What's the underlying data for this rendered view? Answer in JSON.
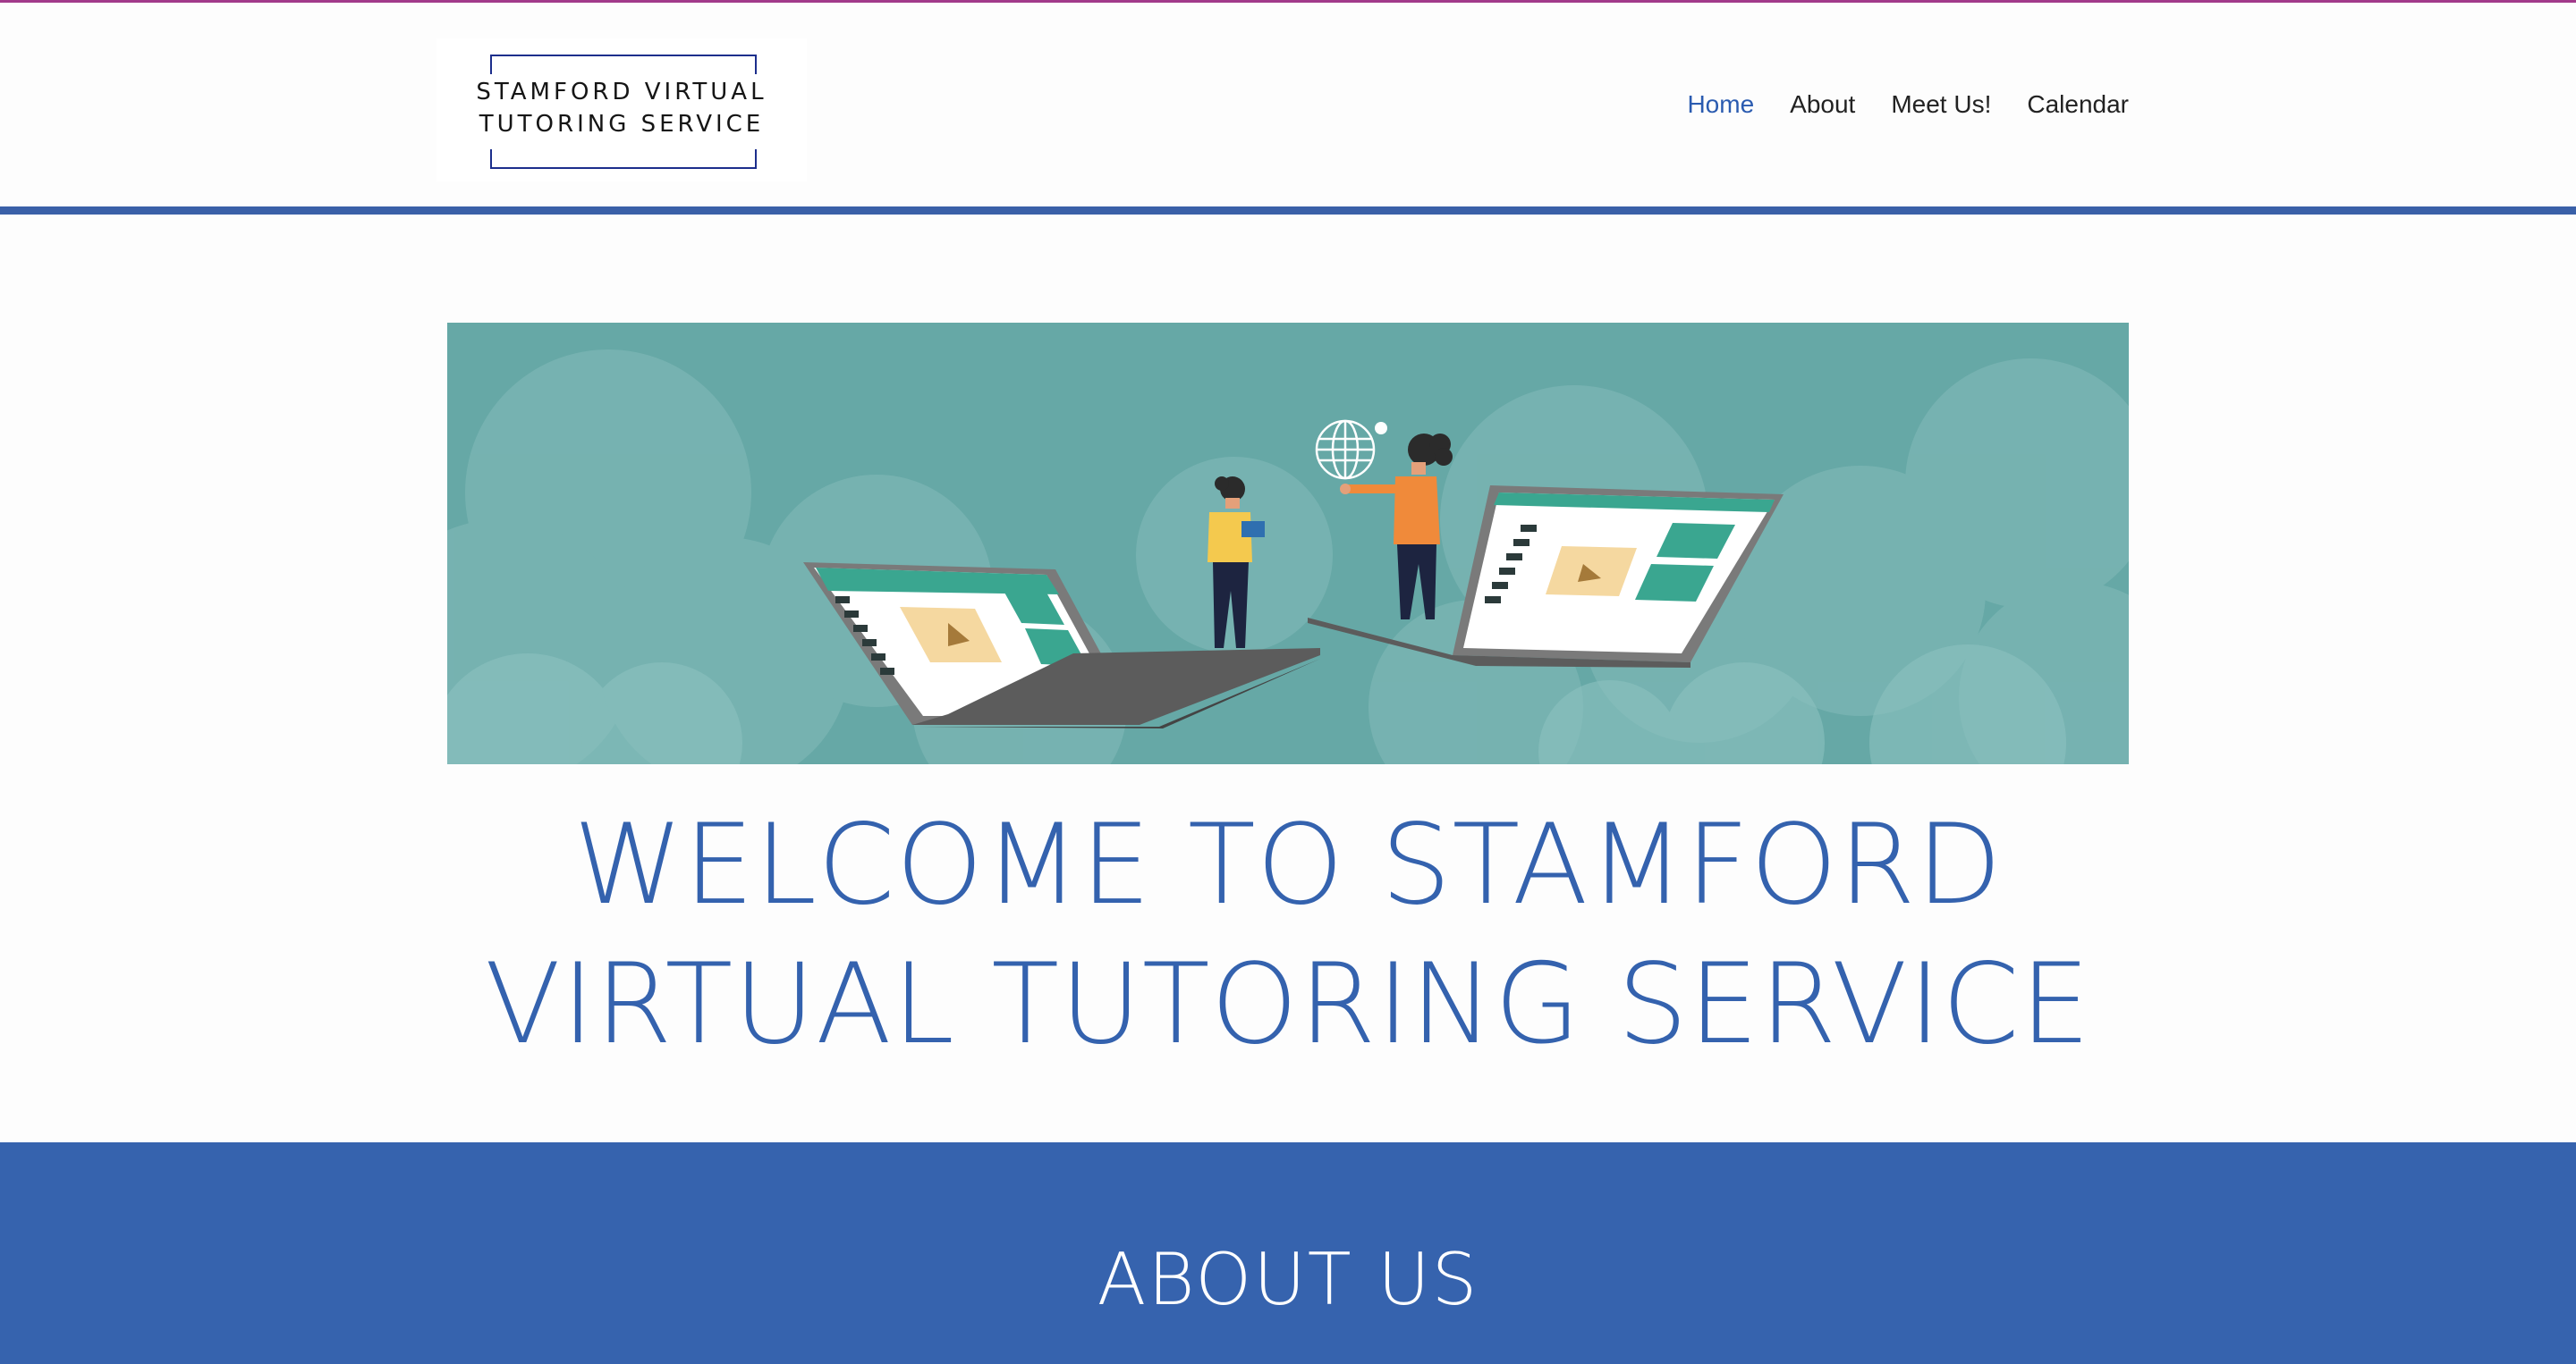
{
  "header": {
    "logo": {
      "line1": "STAMFORD VIRTUAL",
      "line2": "TUTORING SERVICE"
    },
    "nav": [
      {
        "label": "Home",
        "active": true
      },
      {
        "label": "About",
        "active": false
      },
      {
        "label": "Meet Us!",
        "active": false
      },
      {
        "label": "Calendar",
        "active": false
      }
    ]
  },
  "main": {
    "welcome_line1": "WELCOME TO STAMFORD",
    "welcome_line2": "VIRTUAL TUTORING SERVICE",
    "about_heading": "ABOUT US"
  },
  "colors": {
    "accent_blue": "#3663ae",
    "nav_active": "#2a5bb0",
    "banner_teal": "#66a8a6",
    "top_accent": "#a23a8a"
  },
  "icons": {
    "banner_illustration": "online-learning-laptops-illustration",
    "globe": "globe-icon",
    "play": "play-icon"
  }
}
